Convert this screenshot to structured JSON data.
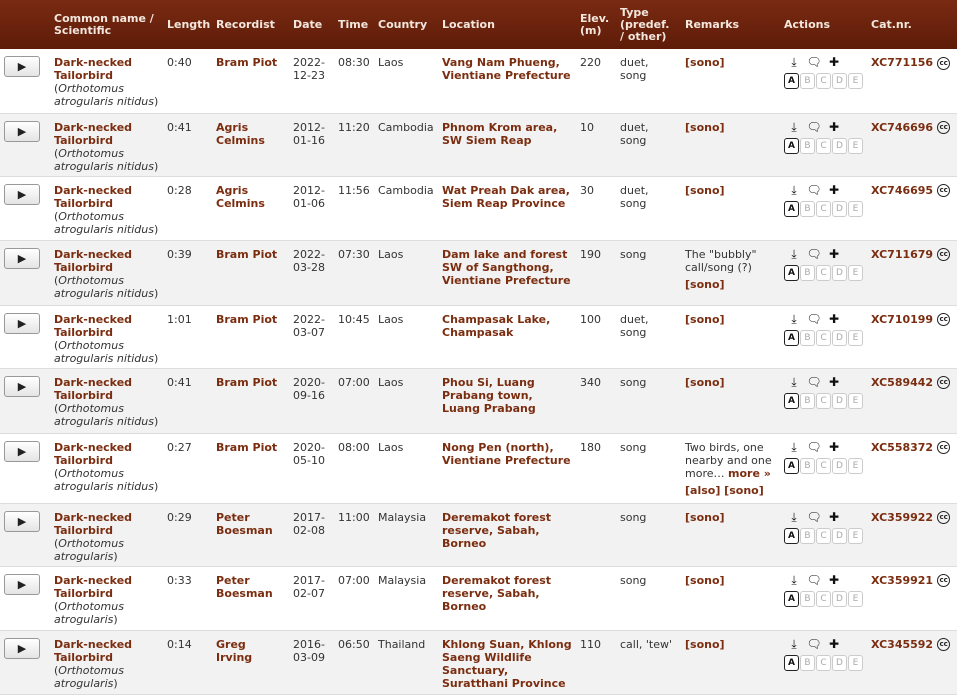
{
  "headers": {
    "common": "Common name / Scientific",
    "length": "Length",
    "recordist": "Recordist",
    "date": "Date",
    "time": "Time",
    "country": "Country",
    "location": "Location",
    "elev": "Elev. (m)",
    "type": "Type (predef. / other)",
    "remarks": "Remarks",
    "actions": "Actions",
    "catnr": "Cat.nr."
  },
  "grade_letters": [
    "A",
    "B",
    "C",
    "D",
    "E"
  ],
  "rows": [
    {
      "common": "Dark-necked Tailorbird",
      "sci": "Orthotomus atrogularis nitidus",
      "length": "0:40",
      "recordist": "Bram Piot",
      "date": "2022-12-23",
      "time": "08:30",
      "country": "Laos",
      "location": "Vang Nam Phueng, Vientiane Prefecture",
      "elev": "220",
      "type": "duet, song",
      "remark_text": "",
      "remark_link": "[sono]",
      "catnr": "XC771156"
    },
    {
      "common": "Dark-necked Tailorbird",
      "sci": "Orthotomus atrogularis nitidus",
      "length": "0:41",
      "recordist": "Agris Celmins",
      "date": "2012-01-16",
      "time": "11:20",
      "country": "Cambodia",
      "location": "Phnom Krom area, SW Siem Reap",
      "elev": "10",
      "type": "duet, song",
      "remark_text": "",
      "remark_link": "[sono]",
      "catnr": "XC746696"
    },
    {
      "common": "Dark-necked Tailorbird",
      "sci": "Orthotomus atrogularis nitidus",
      "length": "0:28",
      "recordist": "Agris Celmins",
      "date": "2012-01-06",
      "time": "11:56",
      "country": "Cambodia",
      "location": "Wat Preah Dak area, Siem Reap Province",
      "elev": "30",
      "type": "duet, song",
      "remark_text": "",
      "remark_link": "[sono]",
      "catnr": "XC746695"
    },
    {
      "common": "Dark-necked Tailorbird",
      "sci": "Orthotomus atrogularis nitidus",
      "length": "0:39",
      "recordist": "Bram Piot",
      "date": "2022-03-28",
      "time": "07:30",
      "country": "Laos",
      "location": "Dam lake and forest SW of Sangthong, Vientiane Prefecture",
      "elev": "190",
      "type": "song",
      "remark_text": "The \"bubbly\" call/song (?)",
      "remark_link": "[sono]",
      "catnr": "XC711679"
    },
    {
      "common": "Dark-necked Tailorbird",
      "sci": "Orthotomus atrogularis nitidus",
      "length": "1:01",
      "recordist": "Bram Piot",
      "date": "2022-03-07",
      "time": "10:45",
      "country": "Laos",
      "location": "Champasak Lake, Champasak",
      "elev": "100",
      "type": "duet, song",
      "remark_text": "",
      "remark_link": "[sono]",
      "catnr": "XC710199"
    },
    {
      "common": "Dark-necked Tailorbird",
      "sci": "Orthotomus atrogularis nitidus",
      "length": "0:41",
      "recordist": "Bram Piot",
      "date": "2020-09-16",
      "time": "07:00",
      "country": "Laos",
      "location": "Phou Si, Luang Prabang town, Luang Prabang",
      "elev": "340",
      "type": "song",
      "remark_text": "",
      "remark_link": "[sono]",
      "catnr": "XC589442"
    },
    {
      "common": "Dark-necked Tailorbird",
      "sci": "Orthotomus atrogularis nitidus",
      "length": "0:27",
      "recordist": "Bram Piot",
      "date": "2020-05-10",
      "time": "08:00",
      "country": "Laos",
      "location": "Nong Pen (north), Vientiane Prefecture",
      "elev": "180",
      "type": "song",
      "remark_text": "Two birds, one nearby and one more…",
      "remark_more": "more »",
      "remark_link": "[also] [sono]",
      "catnr": "XC558372"
    },
    {
      "common": "Dark-necked Tailorbird",
      "sci": "Orthotomus atrogularis",
      "length": "0:29",
      "recordist": "Peter Boesman",
      "date": "2017-02-08",
      "time": "11:00",
      "country": "Malaysia",
      "location": "Deremakot forest reserve, Sabah, Borneo",
      "elev": "",
      "type": "song",
      "remark_text": "",
      "remark_link": "[sono]",
      "catnr": "XC359922"
    },
    {
      "common": "Dark-necked Tailorbird",
      "sci": "Orthotomus atrogularis",
      "length": "0:33",
      "recordist": "Peter Boesman",
      "date": "2017-02-07",
      "time": "07:00",
      "country": "Malaysia",
      "location": "Deremakot forest reserve, Sabah, Borneo",
      "elev": "",
      "type": "song",
      "remark_text": "",
      "remark_link": "[sono]",
      "catnr": "XC359921"
    },
    {
      "common": "Dark-necked Tailorbird",
      "sci": "Orthotomus atrogularis",
      "length": "0:14",
      "recordist": "Greg Irving",
      "date": "2016-03-09",
      "time": "06:50",
      "country": "Thailand",
      "location": "Khlong Suan, Khlong Saeng Wildlife Sanctuary, Suratthani Province",
      "elev": "110",
      "type": "call, 'tew'",
      "remark_text": "",
      "remark_link": "[sono]",
      "catnr": "XC345592"
    }
  ],
  "icons": {
    "play": "play-icon",
    "download": "download-icon",
    "discuss": "speech-bubble-icon",
    "add": "add-to-set-icon",
    "license": "cc-icon"
  },
  "colors": {
    "header_bg": "#6b2310",
    "link": "#7b2d10"
  }
}
